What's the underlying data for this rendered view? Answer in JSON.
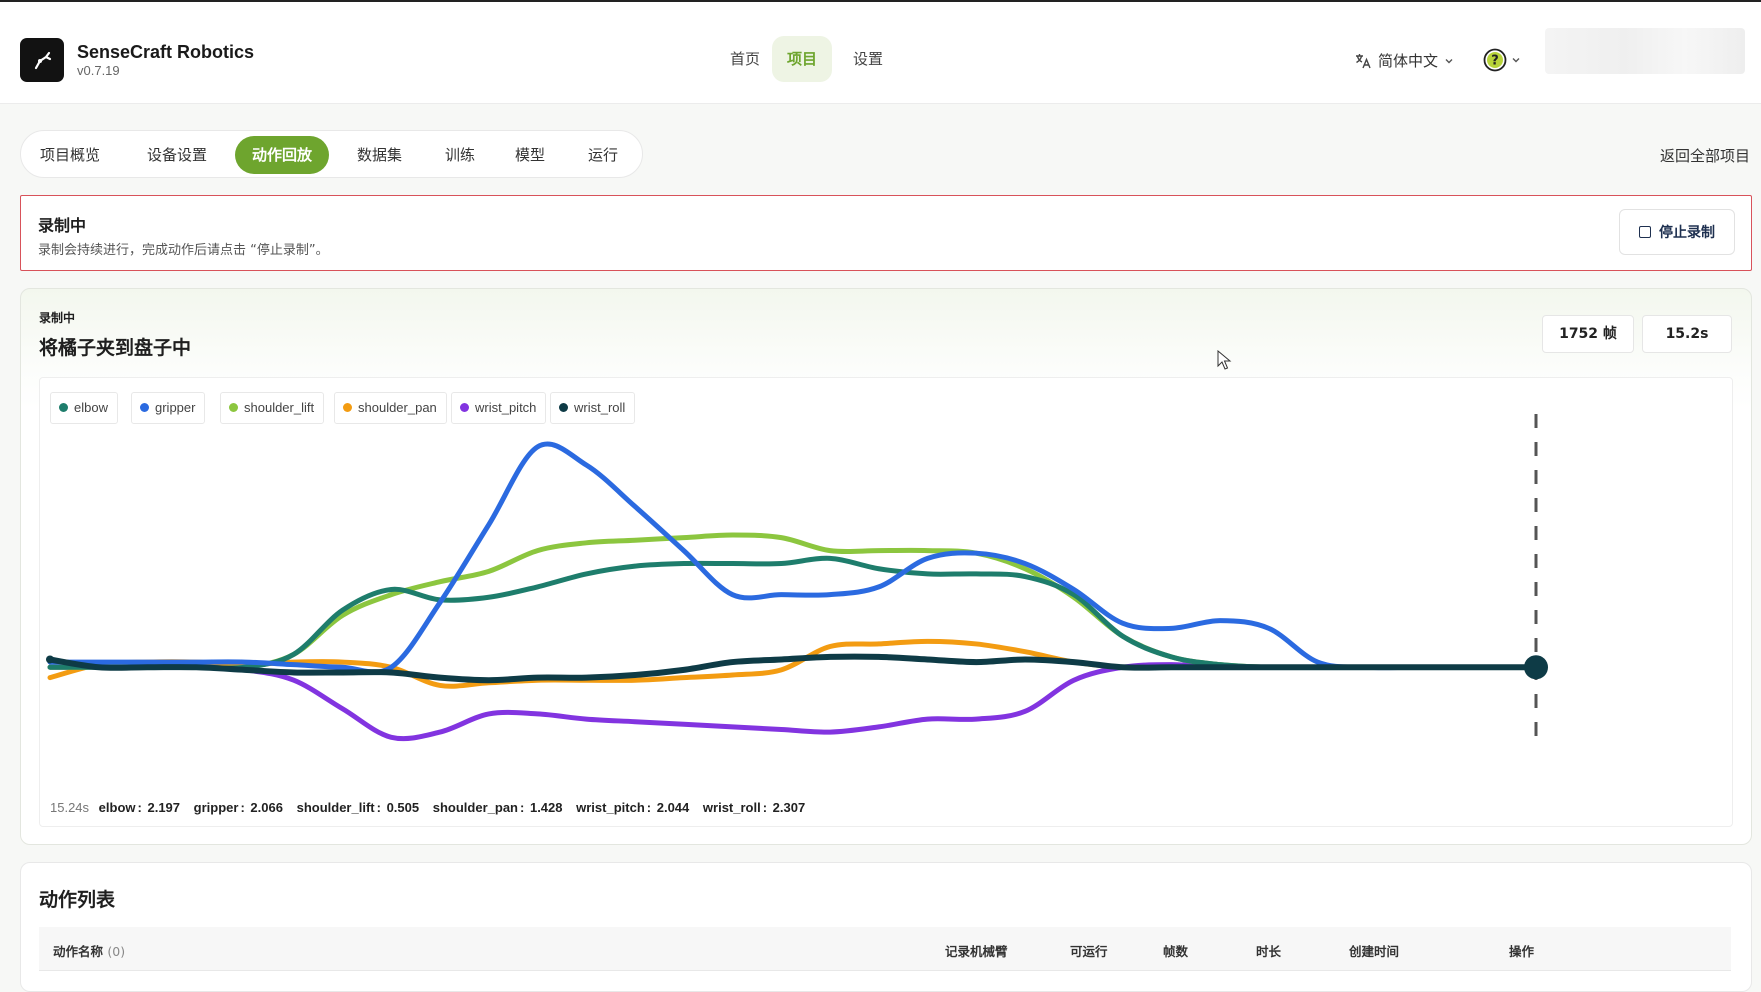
{
  "app": {
    "name": "SenseCraft Robotics",
    "version": "v0.7.19"
  },
  "topnav": {
    "home": "首页",
    "projects": "项目",
    "settings": "设置"
  },
  "language": "简体中文",
  "subtabs": [
    "项目概览",
    "设备设置",
    "动作回放",
    "数据集",
    "训练",
    "模型",
    "运行"
  ],
  "back_all": "返回全部项目",
  "banner": {
    "title": "录制中",
    "desc": "录制会持续进行，完成动作后请点击 “停止录制”。",
    "stop": "停止录制"
  },
  "chart_card": {
    "badge": "录制中",
    "title": "将橘子夹到盘子中",
    "frames": "1752 帧",
    "duration": "15.2s"
  },
  "readout": {
    "time": "15.24s",
    "items": [
      {
        "name": "elbow",
        "value": "2.197"
      },
      {
        "name": "gripper",
        "value": "2.066"
      },
      {
        "name": "shoulder_lift",
        "value": "0.505"
      },
      {
        "name": "shoulder_pan",
        "value": "1.428"
      },
      {
        "name": "wrist_pitch",
        "value": "2.044"
      },
      {
        "name": "wrist_roll",
        "value": "2.307"
      }
    ]
  },
  "chart_data": {
    "type": "line",
    "title": "",
    "xlabel": "",
    "ylabel": "",
    "xlim": [
      0,
      15.24
    ],
    "ylim": [
      -0.35,
      1.0
    ],
    "grid": false,
    "legend_position": "top-left",
    "x": [
      0,
      0.5,
      1,
      1.5,
      2,
      2.5,
      3,
      3.5,
      4,
      4.5,
      5,
      5.5,
      6,
      6.5,
      7,
      7.5,
      8,
      8.5,
      9,
      9.5,
      10,
      10.5,
      11,
      11.5,
      12,
      12.5,
      13,
      13.5,
      14,
      14.5,
      15,
      15.24
    ],
    "series": [
      {
        "name": "elbow",
        "color": "#1e7d6c",
        "values": [
          0,
          0,
          0,
          0,
          0,
          0.05,
          0.22,
          0.3,
          0.26,
          0.27,
          0.31,
          0.36,
          0.39,
          0.4,
          0.4,
          0.4,
          0.42,
          0.38,
          0.36,
          0.36,
          0.35,
          0.28,
          0.12,
          0.04,
          0.01,
          0,
          0,
          0,
          0,
          0,
          0,
          0
        ]
      },
      {
        "name": "gripper",
        "color": "#2b6ae0",
        "values": [
          0.02,
          0.02,
          0.02,
          0.02,
          0.02,
          0.01,
          0,
          0,
          0.25,
          0.55,
          0.85,
          0.78,
          0.62,
          0.45,
          0.28,
          0.28,
          0.28,
          0.31,
          0.42,
          0.44,
          0.4,
          0.3,
          0.17,
          0.15,
          0.18,
          0.15,
          0.02,
          0,
          0,
          0,
          0,
          0
        ]
      },
      {
        "name": "shoulder_lift",
        "color": "#8cc63f",
        "values": [
          0,
          0,
          0,
          0,
          0,
          0.05,
          0.2,
          0.28,
          0.33,
          0.37,
          0.45,
          0.48,
          0.49,
          0.5,
          0.51,
          0.5,
          0.45,
          0.45,
          0.45,
          0.44,
          0.38,
          0.27,
          0.12,
          0.04,
          0.01,
          0,
          0,
          0,
          0,
          0,
          0,
          0
        ]
      },
      {
        "name": "shoulder_pan",
        "color": "#f39c12",
        "values": [
          -0.04,
          0.01,
          0.02,
          0.02,
          0.01,
          0.02,
          0.02,
          0,
          -0.07,
          -0.06,
          -0.05,
          -0.05,
          -0.05,
          -0.04,
          -0.03,
          -0.01,
          0.08,
          0.09,
          0.1,
          0.09,
          0.06,
          0.02,
          0,
          0,
          0,
          0,
          0,
          0,
          0,
          0,
          0,
          0
        ]
      },
      {
        "name": "wrist_pitch",
        "color": "#8234e0",
        "values": [
          0,
          0,
          0,
          0,
          -0.01,
          -0.05,
          -0.16,
          -0.27,
          -0.25,
          -0.18,
          -0.18,
          -0.2,
          -0.21,
          -0.22,
          -0.23,
          -0.24,
          -0.25,
          -0.23,
          -0.2,
          -0.2,
          -0.17,
          -0.05,
          0,
          0.01,
          0,
          0,
          0,
          0,
          0,
          0,
          0,
          0
        ]
      },
      {
        "name": "wrist_roll",
        "color": "#0e3b46",
        "values": [
          0.03,
          0,
          0,
          0,
          -0.01,
          -0.02,
          -0.02,
          -0.02,
          -0.04,
          -0.05,
          -0.04,
          -0.04,
          -0.03,
          -0.01,
          0.02,
          0.03,
          0.04,
          0.04,
          0.03,
          0.02,
          0.03,
          0.02,
          0,
          0,
          0,
          0,
          0,
          0,
          0,
          0,
          0,
          0
        ]
      }
    ]
  },
  "action_list": {
    "title": "动作列表",
    "columns": [
      "动作名称",
      "记录机械臂",
      "可运行",
      "帧数",
      "时长",
      "创建时间",
      "操作"
    ],
    "count": "(0)"
  }
}
